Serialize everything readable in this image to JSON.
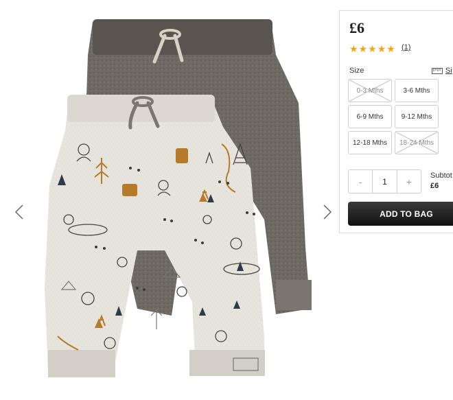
{
  "product": {
    "price": "£6",
    "rating": 5,
    "stars": [
      "★",
      "★",
      "★",
      "★",
      "★"
    ],
    "review_count": "(1)"
  },
  "size": {
    "label": "Size",
    "guide_label": "Si",
    "options": [
      {
        "label": "0-3 Mths",
        "available": false
      },
      {
        "label": "3-6 Mths",
        "available": true
      },
      {
        "label": "6-9 Mths",
        "available": true
      },
      {
        "label": "9-12 Mths",
        "available": true
      },
      {
        "label": "12-18 Mths",
        "available": true
      },
      {
        "label": "18-24 Mths",
        "available": false
      }
    ]
  },
  "quantity": {
    "minus": "-",
    "value": "1",
    "plus": "+"
  },
  "subtotal": {
    "label": "Subtot",
    "value": "£6"
  },
  "add_to_bag": "ADD TO BAG",
  "colors": {
    "star": "#f3a70b",
    "button_dark": "#111111",
    "grey_pants": "#6e6862",
    "cream_pants": "#e6e3dc"
  }
}
